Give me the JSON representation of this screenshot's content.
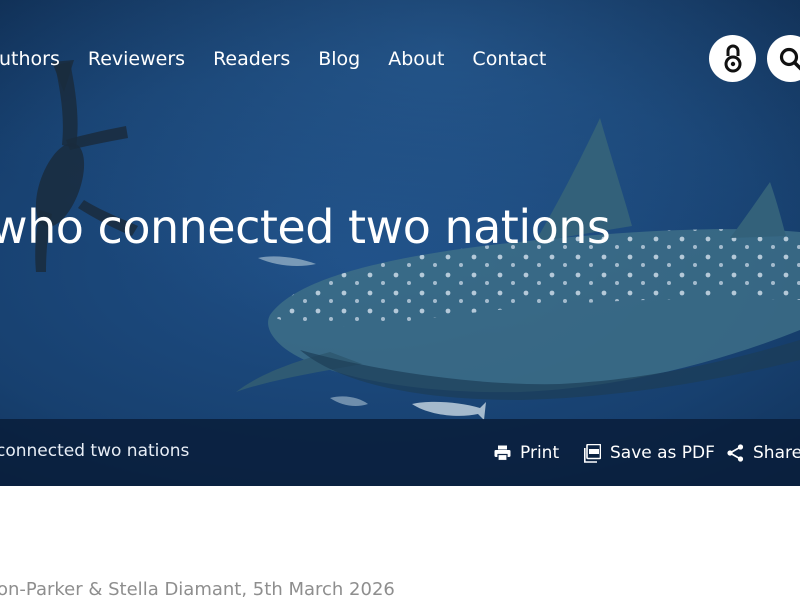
{
  "nav": {
    "links": [
      "Authors",
      "Reviewers",
      "Readers",
      "Blog",
      "About",
      "Contact"
    ],
    "open_access_icon": "open-access-icon",
    "search_icon": "search-icon"
  },
  "hero": {
    "title": "who connected two nations",
    "image_subject": "whale shark and diver underwater"
  },
  "toolbar": {
    "breadcrumb": "connected two nations",
    "print_label": "Print",
    "pdf_label": "Save as PDF",
    "share_label": "Share",
    "print_icon": "printer-icon",
    "pdf_icon": "pdf-icon",
    "share_icon": "share-icon"
  },
  "article": {
    "byline": "on-Parker & Stella Diamant, 5th March 2026"
  },
  "colors": {
    "ocean_deep": "#0a2141",
    "ocean_mid": "#1f4f86",
    "toolbar_bg": "#091c38",
    "byline_text": "#8e8e8e"
  }
}
